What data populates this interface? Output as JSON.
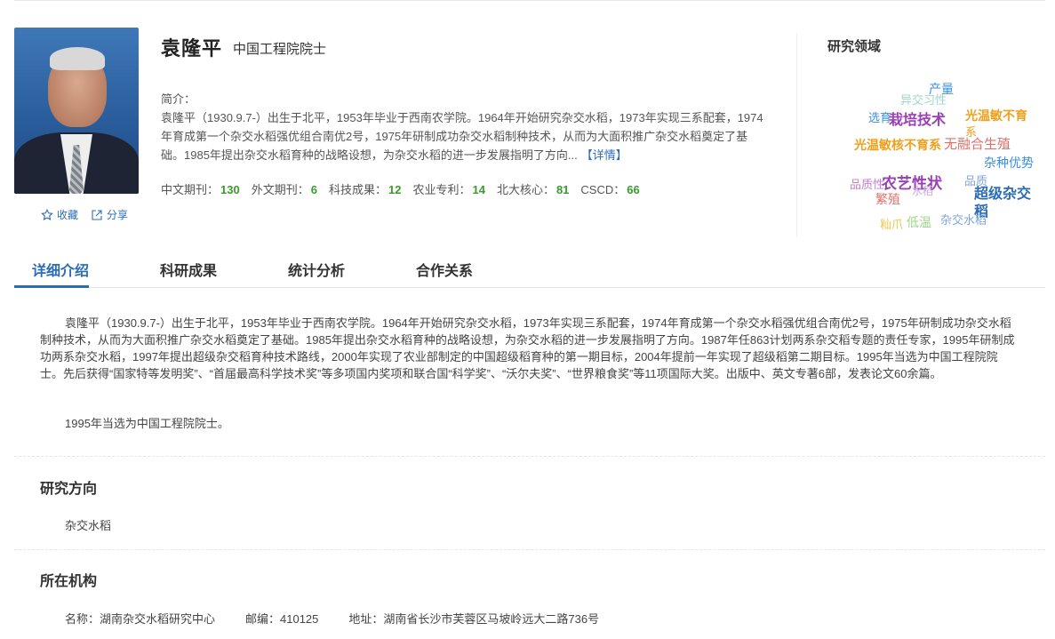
{
  "profile": {
    "name": "袁隆平",
    "title": "中国工程院院士",
    "intro_label": "简介：",
    "intro_text": "袁隆平（1930.9.7-）出生于北平，1953年毕业于西南农学院。1964年开始研究杂交水稻，1973年实现三系配套，1974年育成第一个杂交水稻强优组合南优2号，1975年研制成功杂交水稻制种技术，从而为大面积推广杂交水稻奠定了基础。1985年提出杂交水稻育种的战略设想，为杂交水稻的进一步发展指明了方向...",
    "more_label": "【详情】",
    "collect_label": "收藏",
    "share_label": "分享"
  },
  "stats": [
    {
      "label": "中文期刊：",
      "value": "130"
    },
    {
      "label": "外文期刊：",
      "value": "6"
    },
    {
      "label": "科技成果：",
      "value": "12"
    },
    {
      "label": "农业专利：",
      "value": "14"
    },
    {
      "label": "北大核心：",
      "value": "81"
    },
    {
      "label": "CSCD：",
      "value": "66"
    }
  ],
  "research_field": {
    "title": "研究领域",
    "keywords": [
      {
        "text": "产量",
        "color": "#3a8ee6"
      },
      {
        "text": "异交习性",
        "color": "#9ed7c9"
      },
      {
        "text": "选育",
        "color": "#3a8ee6"
      },
      {
        "text": "栽培技术",
        "color": "#9b3fb5"
      },
      {
        "text": "光温敏不育",
        "color": "#f0a01e"
      },
      {
        "text": "系",
        "color": "#f0a01e"
      },
      {
        "text": "光温敏核不育系",
        "color": "#f0a01e"
      },
      {
        "text": "无融合生殖",
        "color": "#e0706a"
      },
      {
        "text": "杂种优势",
        "color": "#3a8ee6"
      },
      {
        "text": "品质性",
        "color": "#c27fd0"
      },
      {
        "text": "农艺性状",
        "color": "#9b3fb5"
      },
      {
        "text": "品质",
        "color": "#7fa7d9"
      },
      {
        "text": "超级杂交",
        "color": "#2c6cb5"
      },
      {
        "text": "稻",
        "color": "#2c6cb5"
      },
      {
        "text": "繁殖",
        "color": "#e0706a"
      },
      {
        "text": "水稻",
        "color": "#c9a8e6"
      },
      {
        "text": "籼爪",
        "color": "#f0c84a"
      },
      {
        "text": "低温",
        "color": "#9ed78a"
      },
      {
        "text": "杂交水稻",
        "color": "#7fa7d9"
      }
    ]
  },
  "tabs": [
    "详细介绍",
    "科研成果",
    "统计分析",
    "合作关系"
  ],
  "detail": {
    "paragraph1": "袁隆平（1930.9.7-）出生于北平，1953年毕业于西南农学院。1964年开始研究杂交水稻，1973年实现三系配套，1974年育成第一个杂交水稻强优组合南优2号，1975年研制成功杂交水稻制种技术，从而为大面积推广杂交水稻奠定了基础。1985年提出杂交水稻育种的战略设想，为杂交水稻的进一步发展指明了方向。1987年任863计划两系杂交稻专题的责任专家，1995年研制成功两系杂交水稻，1997年提出超级杂交稻育种技术路线，2000年实现了农业部制定的中国超级稻育种的第一期目标，2004年提前一年实现了超级稻第二期目标。1995年当选为中国工程院院士。先后获得“国家特等发明奖”、“首届最高科学技术奖”等多项国内奖项和联合国“科学奖”、“沃尔夫奖”、“世界粮食奖”等11项国际大奖。出版中、英文专著6部，发表论文60余篇。",
    "paragraph2": "1995年当选为中国工程院院士。"
  },
  "research_direction": {
    "title": "研究方向",
    "value": "杂交水稻"
  },
  "institution": {
    "title": "所在机构",
    "name": "名称：湖南杂交水稻研究中心",
    "postcode": "邮编：410125",
    "address": "地址：湖南省长沙市芙蓉区马坡岭远大二路736号"
  }
}
